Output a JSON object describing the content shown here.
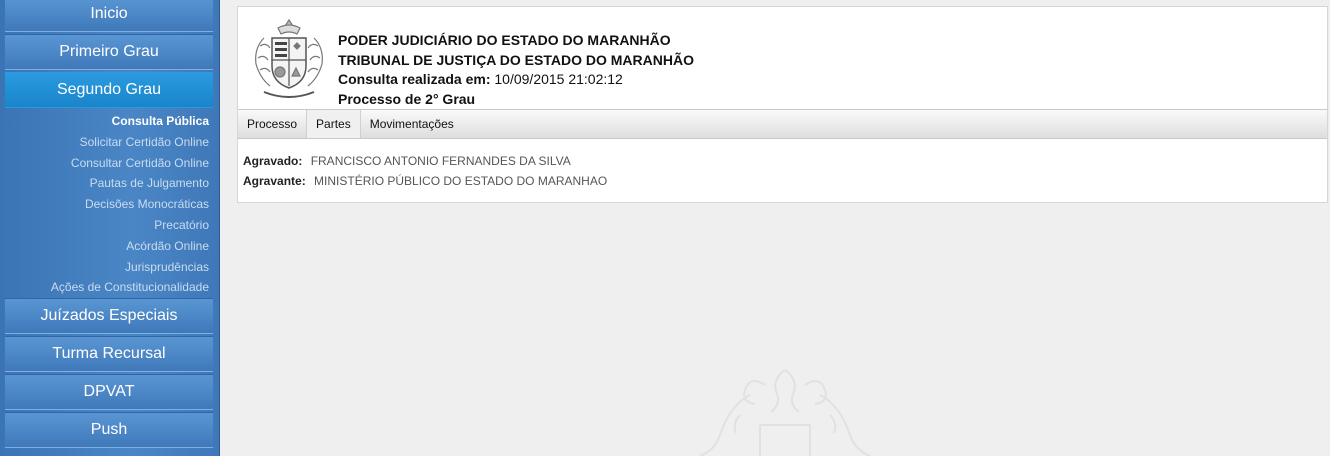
{
  "sidebar": {
    "main_items": [
      {
        "label": "Inicio"
      },
      {
        "label": "Primeiro Grau"
      },
      {
        "label": "Segundo Grau"
      },
      {
        "label": "Juízados Especiais"
      },
      {
        "label": "Turma Recursal"
      },
      {
        "label": "DPVAT"
      },
      {
        "label": "Push"
      }
    ],
    "active_item": "Segundo Grau",
    "sub_items": [
      {
        "label": "Consulta Pública"
      },
      {
        "label": "Solicitar Certidão Online"
      },
      {
        "label": "Consultar Certidão Online"
      },
      {
        "label": "Pautas de Julgamento"
      },
      {
        "label": "Decisões Monocráticas"
      },
      {
        "label": "Precatório"
      },
      {
        "label": "Acórdão Online"
      },
      {
        "label": "Jurisprudências"
      },
      {
        "label": "Ações de Constitucionalidade"
      }
    ],
    "current_sub_item": "Consulta Pública"
  },
  "header": {
    "line1": "PODER JUDICIÁRIO DO ESTADO DO MARANHÃO",
    "line2": "TRIBUNAL DE JUSTIÇA DO ESTADO DO MARANHÃO",
    "consult_label": "Consulta realizada em:",
    "consult_datetime": "10/09/2015 21:02:12",
    "process_label": "Processo de 2° Grau"
  },
  "tabs": [
    {
      "label": "Processo"
    },
    {
      "label": "Partes"
    },
    {
      "label": "Movimentações"
    }
  ],
  "active_tab": "Partes",
  "parties": [
    {
      "role": "Agravado:",
      "name": "FRANCISCO ANTONIO FERNANDES DA SILVA"
    },
    {
      "role": "Agravante:",
      "name": "MINISTÉRIO PÚBLICO DO ESTADO DO MARANHAO"
    }
  ],
  "colors": {
    "sidebar_bg": "#4a86c6",
    "sidebar_active": "#1f8fd6",
    "page_bg": "#efefef"
  },
  "icons": {
    "emblem": "coat-of-arms-icon",
    "watermark": "coat-of-arms-watermark-icon"
  }
}
